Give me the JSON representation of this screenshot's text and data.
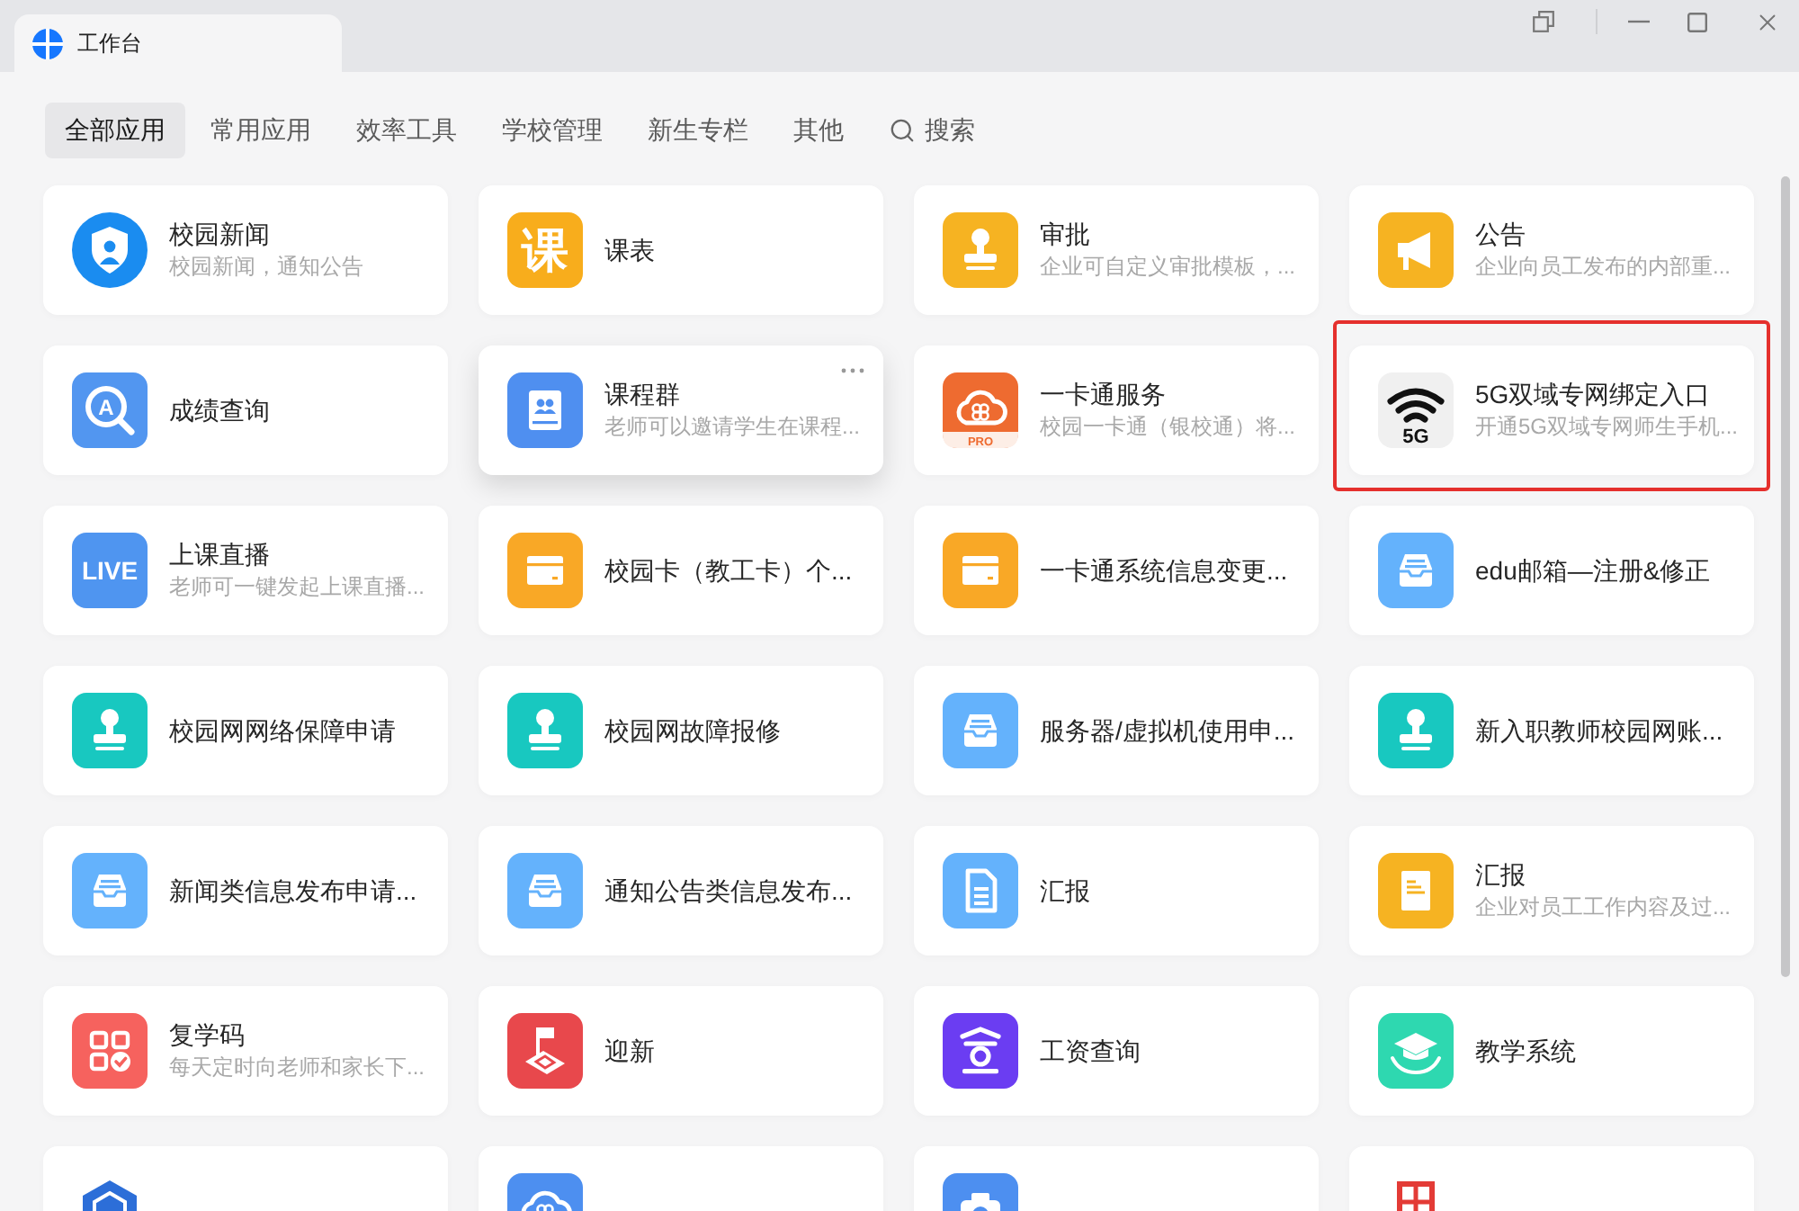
{
  "window": {
    "title": "工作台"
  },
  "tabs": [
    {
      "label": "全部应用",
      "selected": true
    },
    {
      "label": "常用应用",
      "selected": false
    },
    {
      "label": "效率工具",
      "selected": false
    },
    {
      "label": "学校管理",
      "selected": false
    },
    {
      "label": "新生专栏",
      "selected": false
    },
    {
      "label": "其他",
      "selected": false
    }
  ],
  "search": {
    "label": "搜索"
  },
  "apps": [
    {
      "title": "校园新闻",
      "subtitle": "校园新闻，通知公告",
      "kind": "shield",
      "color": "#1a8cf0",
      "hovered": false,
      "highlighted": false
    },
    {
      "title": "课表",
      "kind": "glyph",
      "icon_text": "课",
      "color": "#f8ad1c",
      "hovered": false,
      "highlighted": false
    },
    {
      "title": "审批",
      "subtitle": "企业可自定义审批模板，...",
      "kind": "stamp",
      "color": "#f6b322",
      "hovered": false,
      "highlighted": false
    },
    {
      "title": "公告",
      "subtitle": "企业向员工发布的内部重...",
      "kind": "megaphone",
      "color": "#f6b322",
      "hovered": false,
      "highlighted": false
    },
    {
      "title": "成绩查询",
      "kind": "magnifier",
      "icon_text": "A",
      "color": "#5296f0",
      "hovered": false,
      "highlighted": false
    },
    {
      "title": "课程群",
      "subtitle": "老师可以邀请学生在课程...",
      "kind": "book",
      "color": "#4f8ff0",
      "hovered": true,
      "highlighted": false
    },
    {
      "title": "一卡通服务",
      "subtitle": "校园一卡通（银校通）将...",
      "kind": "cloud",
      "icon_text": "PRO",
      "color": "#ee6b30",
      "hovered": false,
      "highlighted": false
    },
    {
      "title": "5G双域专网绑定入口",
      "subtitle": "开通5G双域专网师生手机...",
      "kind": "wifi",
      "icon_text": "5G",
      "color": "#f0f0f0",
      "hovered": false,
      "highlighted": true
    },
    {
      "title": "上课直播",
      "subtitle": "老师可一键发起上课直播...",
      "kind": "glyph",
      "icon_text": "LIVE",
      "color": "#4f95f0",
      "hovered": false,
      "highlighted": false
    },
    {
      "title": "校园卡（教工卡）个...",
      "kind": "card",
      "color": "#f9a826",
      "hovered": false,
      "highlighted": false
    },
    {
      "title": "一卡通系统信息变更...",
      "kind": "card",
      "color": "#f9a826",
      "hovered": false,
      "highlighted": false
    },
    {
      "title": "edu邮箱—注册&修正",
      "kind": "inbox",
      "color": "#64b2fc",
      "hovered": false,
      "highlighted": false
    },
    {
      "title": "校园网网络保障申请",
      "kind": "stamp",
      "color": "#18c8c0",
      "hovered": false,
      "highlighted": false
    },
    {
      "title": "校园网故障报修",
      "kind": "stamp",
      "color": "#18c8c0",
      "hovered": false,
      "highlighted": false
    },
    {
      "title": "服务器/虚拟机使用申...",
      "kind": "inbox",
      "color": "#64b2fc",
      "hovered": false,
      "highlighted": false
    },
    {
      "title": "新入职教师校园网账...",
      "kind": "stamp",
      "color": "#18c8c0",
      "hovered": false,
      "highlighted": false
    },
    {
      "title": "新闻类信息发布申请...",
      "kind": "inbox",
      "color": "#64b2fc",
      "hovered": false,
      "highlighted": false
    },
    {
      "title": "通知公告类信息发布...",
      "kind": "inbox",
      "color": "#64b2fc",
      "hovered": false,
      "highlighted": false
    },
    {
      "title": "汇报",
      "kind": "document",
      "color": "#64b2fc",
      "hovered": false,
      "highlighted": false
    },
    {
      "title": "汇报",
      "subtitle": "企业对员工工作内容及过...",
      "kind": "note",
      "color": "#f6b322",
      "hovered": false,
      "highlighted": false
    },
    {
      "title": "复学码",
      "subtitle": "每天定时向老师和家长下...",
      "kind": "qr",
      "color": "#f6625e",
      "hovered": false,
      "highlighted": false
    },
    {
      "title": "迎新",
      "kind": "flag",
      "color": "#e8484c",
      "hovered": false,
      "highlighted": false
    },
    {
      "title": "工资查询",
      "kind": "emblem",
      "color": "#6b3df2",
      "hovered": false,
      "highlighted": false
    },
    {
      "title": "教学系统",
      "kind": "graduation",
      "color": "#2ed8b0",
      "hovered": false,
      "highlighted": false
    },
    {
      "kind": "hexagon",
      "color": "#2c6ed8",
      "hovered": false,
      "highlighted": false
    },
    {
      "kind": "cloud",
      "color": "#4d8ff0",
      "hovered": false,
      "highlighted": false
    },
    {
      "kind": "camera",
      "color": "#4d8ff0",
      "hovered": false,
      "highlighted": false
    },
    {
      "kind": "table",
      "color": "#e33b36",
      "hovered": false,
      "highlighted": false
    }
  ]
}
